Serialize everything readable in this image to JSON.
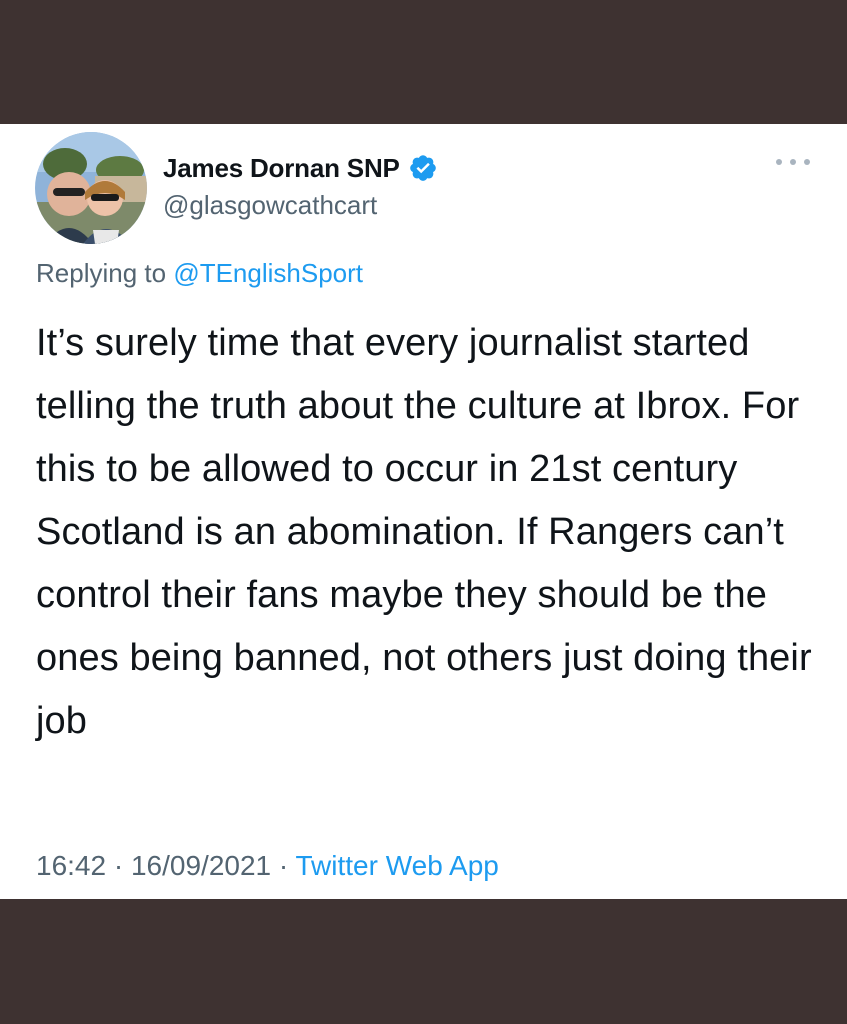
{
  "tweet": {
    "author_name": "James Dornan SNP",
    "handle": "@glasgowcathcart",
    "replying_prefix": "Replying to",
    "replying_to": "@TEnglishSport",
    "text": "It’s surely time that every journalist started telling the truth about the culture at Ibrox. For this to be allowed to occur in 21st century Scotland is an abomination. If Rangers can’t control their fans maybe they should be the ones being banned, not others just doing their job",
    "time": "16:42",
    "date": "16/09/2021",
    "separator": "·",
    "source": "Twitter Web App"
  },
  "icons": {
    "verified": "verified-badge-icon",
    "more": "more-options-icon",
    "avatar": "profile-photo"
  },
  "colors": {
    "background": "#3e3231",
    "card": "#ffffff",
    "text": "#0f1419",
    "secondary": "#536471",
    "link": "#1d9bf0"
  }
}
